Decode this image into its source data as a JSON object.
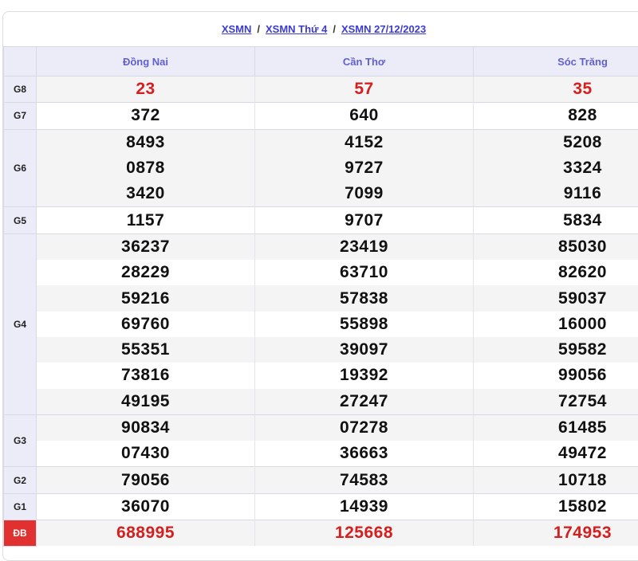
{
  "breadcrumb": {
    "items": [
      "XSMN",
      "XSMN Thứ 4",
      "XSMN 27/12/2023"
    ],
    "separator": "/"
  },
  "provinces": [
    "Đồng Nai",
    "Cần Thơ",
    "Sóc Trăng"
  ],
  "prizes": [
    {
      "label": "G8",
      "rows": [
        [
          "23",
          "57",
          "35"
        ]
      ],
      "highlight": true
    },
    {
      "label": "G7",
      "rows": [
        [
          "372",
          "640",
          "828"
        ]
      ]
    },
    {
      "label": "G6",
      "rows": [
        [
          "8493",
          "4152",
          "5208"
        ],
        [
          "0878",
          "9727",
          "3324"
        ],
        [
          "3420",
          "7099",
          "9116"
        ]
      ]
    },
    {
      "label": "G5",
      "rows": [
        [
          "1157",
          "9707",
          "5834"
        ]
      ]
    },
    {
      "label": "G4",
      "rows": [
        [
          "36237",
          "23419",
          "85030"
        ],
        [
          "28229",
          "63710",
          "82620"
        ],
        [
          "59216",
          "57838",
          "59037"
        ],
        [
          "69760",
          "55898",
          "16000"
        ],
        [
          "55351",
          "39097",
          "59582"
        ],
        [
          "73816",
          "19392",
          "99056"
        ],
        [
          "49195",
          "27247",
          "72754"
        ]
      ]
    },
    {
      "label": "G3",
      "rows": [
        [
          "90834",
          "07278",
          "61485"
        ],
        [
          "07430",
          "36663",
          "49472"
        ]
      ]
    },
    {
      "label": "G2",
      "rows": [
        [
          "79056",
          "74583",
          "10718"
        ]
      ]
    },
    {
      "label": "G1",
      "rows": [
        [
          "36070",
          "14939",
          "15802"
        ]
      ]
    },
    {
      "label": "ĐB",
      "rows": [
        [
          "688995",
          "125668",
          "174953"
        ]
      ],
      "highlight": true,
      "special": true
    }
  ],
  "colors": {
    "link": "#3b3bd6",
    "header_bg": "#ececf8",
    "header_text": "#6060d0",
    "highlight": "#d51f1f",
    "special_label_bg": "#e03030"
  }
}
